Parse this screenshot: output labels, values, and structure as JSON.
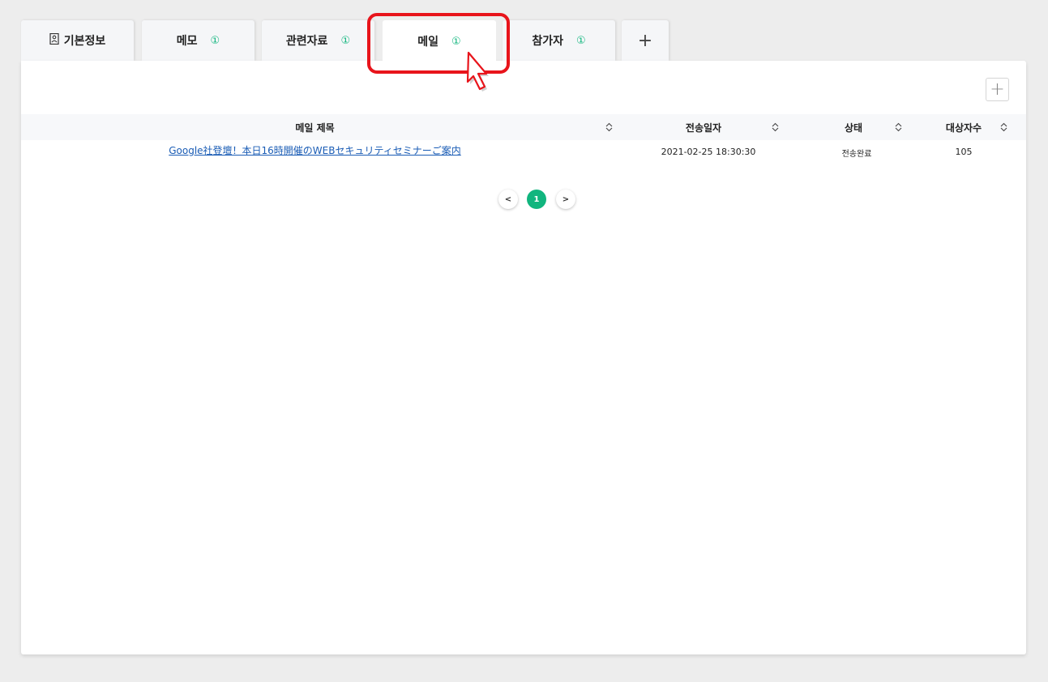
{
  "tabs": [
    {
      "label": "기본정보",
      "count": "",
      "icon": "person-card-icon"
    },
    {
      "label": "메모",
      "count": "①"
    },
    {
      "label": "관련자료",
      "count": "①"
    },
    {
      "label": "메일",
      "count": "①",
      "active": true
    },
    {
      "label": "참가자",
      "count": "①"
    },
    {
      "label": "+",
      "type": "add"
    }
  ],
  "toolbar": {
    "add_label": "+"
  },
  "table": {
    "columns": [
      "메일 제목",
      "전송일자",
      "상태",
      "대상자수"
    ],
    "rows": [
      {
        "title": "Google社登壇！本日16時開催のWEBセキュリティセミナーご案内",
        "sent_at": "2021-02-25 18:30:30",
        "status": "전송완료",
        "recipients": "105"
      }
    ]
  },
  "pagination": {
    "prev": "<",
    "current": "1",
    "next": ">"
  },
  "colors": {
    "accent": "#11b57e",
    "highlight": "#e8141b",
    "link": "#1a5cb5"
  }
}
